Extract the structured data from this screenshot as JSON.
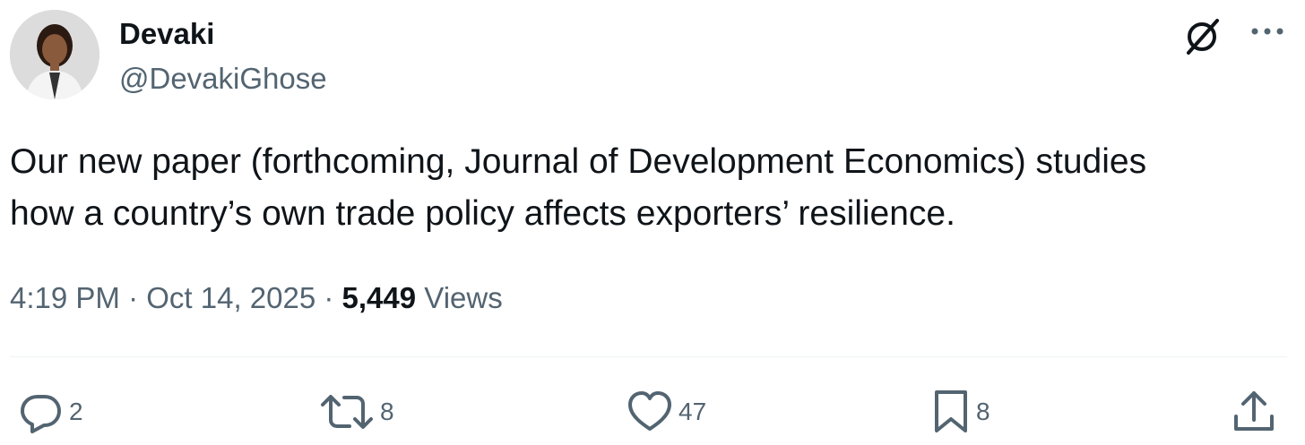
{
  "author": {
    "display_name": "Devaki",
    "handle": "@DevakiGhose"
  },
  "tweet": {
    "text_lines": [
      "Our new paper (forthcoming, Journal of Development Economics) studies",
      "how a country’s own trade policy affects exporters’ resilience."
    ]
  },
  "meta": {
    "time": "4:19 PM",
    "separator": " · ",
    "date": "Oct 14, 2025",
    "views_count": "5,449",
    "views_label": " Views"
  },
  "actions": {
    "replies": "2",
    "reposts": "8",
    "likes": "47",
    "bookmarks": "8"
  },
  "icons": {
    "top_right": [
      "grok-icon",
      "more-options-icon"
    ],
    "action_bar": [
      "reply-icon",
      "repost-icon",
      "like-icon",
      "bookmark-icon",
      "share-icon"
    ]
  },
  "colors": {
    "text_primary": "#0f1419",
    "text_secondary": "#536471",
    "divider": "#eff3f4"
  }
}
